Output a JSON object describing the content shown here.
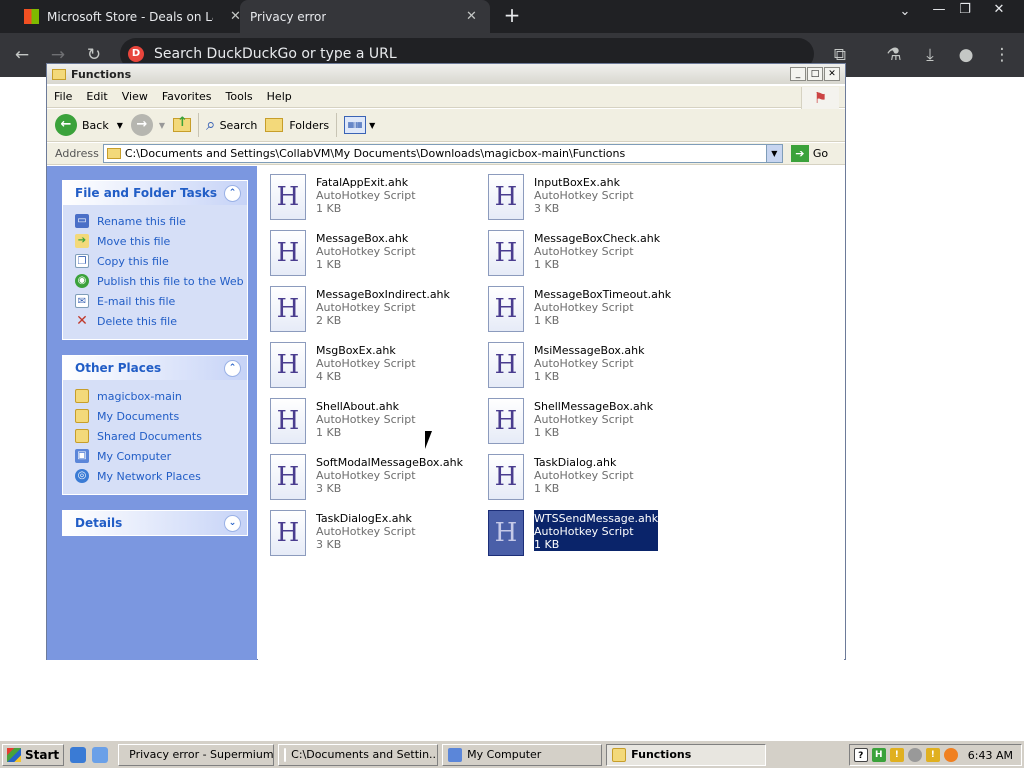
{
  "browser": {
    "tabs": [
      {
        "title": "Microsoft Store - Deals on Laptops",
        "active": false
      },
      {
        "title": "Privacy error",
        "active": true
      }
    ],
    "new_tab": "+",
    "url_placeholder": "Search DuckDuckGo or type a URL",
    "window_controls": {
      "minimize": "—",
      "restore": "❐",
      "close": "✕"
    }
  },
  "explorer": {
    "title": "Functions",
    "menu": [
      "File",
      "Edit",
      "View",
      "Favorites",
      "Tools",
      "Help"
    ],
    "toolbar": {
      "back": "Back",
      "search": "Search",
      "folders": "Folders"
    },
    "address": {
      "label": "Address",
      "value": "C:\\Documents and Settings\\CollabVM\\My Documents\\Downloads\\magicbox-main\\Functions",
      "go": "Go"
    },
    "file_tasks": {
      "header": "File and Folder Tasks",
      "items": [
        {
          "label": "Rename this file",
          "icon": "rename-icon"
        },
        {
          "label": "Move this file",
          "icon": "move-icon"
        },
        {
          "label": "Copy this file",
          "icon": "copy-icon"
        },
        {
          "label": "Publish this file to the Web",
          "icon": "publish-icon"
        },
        {
          "label": "E-mail this file",
          "icon": "email-icon"
        },
        {
          "label": "Delete this file",
          "icon": "delete-icon"
        }
      ]
    },
    "other_places": {
      "header": "Other Places",
      "items": [
        {
          "label": "magicbox-main",
          "icon": "folder-icon"
        },
        {
          "label": "My Documents",
          "icon": "folder-icon"
        },
        {
          "label": "Shared Documents",
          "icon": "folder-icon"
        },
        {
          "label": "My Computer",
          "icon": "computer-icon"
        },
        {
          "label": "My Network Places",
          "icon": "network-icon"
        }
      ]
    },
    "details": {
      "header": "Details"
    },
    "files": [
      {
        "name": "FatalAppExit.ahk",
        "type": "AutoHotkey Script",
        "size": "1 KB",
        "selected": false
      },
      {
        "name": "InputBoxEx.ahk",
        "type": "AutoHotkey Script",
        "size": "3 KB",
        "selected": false
      },
      {
        "name": "MessageBox.ahk",
        "type": "AutoHotkey Script",
        "size": "1 KB",
        "selected": false
      },
      {
        "name": "MessageBoxCheck.ahk",
        "type": "AutoHotkey Script",
        "size": "1 KB",
        "selected": false
      },
      {
        "name": "MessageBoxIndirect.ahk",
        "type": "AutoHotkey Script",
        "size": "2 KB",
        "selected": false
      },
      {
        "name": "MessageBoxTimeout.ahk",
        "type": "AutoHotkey Script",
        "size": "1 KB",
        "selected": false
      },
      {
        "name": "MsgBoxEx.ahk",
        "type": "AutoHotkey Script",
        "size": "4 KB",
        "selected": false
      },
      {
        "name": "MsiMessageBox.ahk",
        "type": "AutoHotkey Script",
        "size": "1 KB",
        "selected": false
      },
      {
        "name": "ShellAbout.ahk",
        "type": "AutoHotkey Script",
        "size": "1 KB",
        "selected": false
      },
      {
        "name": "ShellMessageBox.ahk",
        "type": "AutoHotkey Script",
        "size": "1 KB",
        "selected": false
      },
      {
        "name": "SoftModalMessageBox.ahk",
        "type": "AutoHotkey Script",
        "size": "3 KB",
        "selected": false
      },
      {
        "name": "TaskDialog.ahk",
        "type": "AutoHotkey Script",
        "size": "1 KB",
        "selected": false
      },
      {
        "name": "TaskDialogEx.ahk",
        "type": "AutoHotkey Script",
        "size": "3 KB",
        "selected": false
      },
      {
        "name": "WTSSendMessage.ahk",
        "type": "AutoHotkey Script",
        "size": "1 KB",
        "selected": true
      }
    ]
  },
  "taskbar": {
    "start": "Start",
    "tasks": [
      {
        "label": "Privacy error - Supermium",
        "active": false
      },
      {
        "label": "C:\\Documents and Settin...",
        "active": false
      },
      {
        "label": "My Computer",
        "active": false
      },
      {
        "label": "Functions",
        "active": true
      }
    ],
    "clock": "6:43 AM"
  },
  "colors": {
    "xp_blue_pane": "#7b97e0",
    "task_link": "#215dc6",
    "selection": "#0a246a",
    "browser_dark": "#202124"
  }
}
